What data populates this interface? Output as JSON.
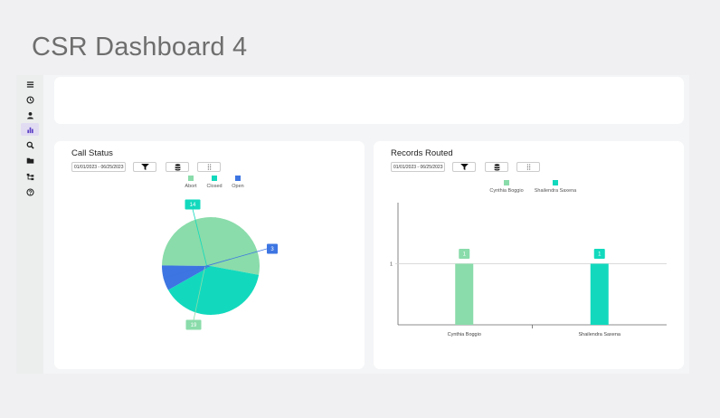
{
  "page": {
    "title": "CSR Dashboard 4"
  },
  "sidebar": {
    "items": [
      {
        "icon": "menu-icon"
      },
      {
        "icon": "clock-icon"
      },
      {
        "icon": "user-icon"
      },
      {
        "icon": "bar-chart-icon",
        "active": true
      },
      {
        "icon": "search-icon"
      },
      {
        "icon": "folder-icon"
      },
      {
        "icon": "hierarchy-icon"
      },
      {
        "icon": "help-icon"
      }
    ]
  },
  "panels": {
    "call_status": {
      "title": "Call Status",
      "date_range": "01/01/2023 - 06/25/2023",
      "toolbar": [
        "filter-icon",
        "database-icon",
        "drag-handle-icon"
      ]
    },
    "records_routed": {
      "title": "Records Routed",
      "date_range": "01/01/2023 - 06/25/2023",
      "toolbar": [
        "filter-icon",
        "database-icon",
        "drag-handle-icon"
      ]
    }
  },
  "chart_data": [
    {
      "type": "pie",
      "categories": [
        "Abort",
        "Closed",
        "Open"
      ],
      "values": [
        19,
        14,
        3
      ],
      "colors": [
        "#8adcaa",
        "#12d9bd",
        "#3d75e2"
      ],
      "data_labels": [
        "19",
        "14",
        "3"
      ],
      "legend_position": "top"
    },
    {
      "type": "bar",
      "categories": [
        "Cynthia Boggio",
        "Shailendra Saxena"
      ],
      "values": [
        1,
        1
      ],
      "colors": [
        "#8adcaa",
        "#12d9bd"
      ],
      "data_labels": [
        "1",
        "1"
      ],
      "yticks": [
        "1"
      ],
      "ylim": [
        0,
        2
      ],
      "grid": true,
      "legend_position": "top"
    }
  ]
}
